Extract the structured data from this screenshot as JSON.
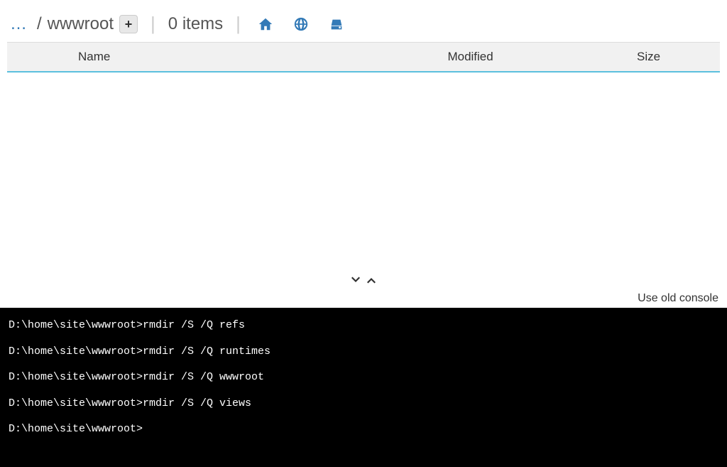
{
  "breadcrumb": {
    "ellipsis": "…",
    "slash": "/",
    "current": "wwwroot",
    "add_label": "+"
  },
  "toolbar": {
    "item_count": "0 items"
  },
  "table": {
    "headers": {
      "name": "Name",
      "modified": "Modified",
      "size": "Size"
    }
  },
  "console_link": "Use old console",
  "console_lines": [
    "D:\\home\\site\\wwwroot>rmdir /S /Q refs",
    "D:\\home\\site\\wwwroot>rmdir /S /Q runtimes",
    "D:\\home\\site\\wwwroot>rmdir /S /Q wwwroot",
    "D:\\home\\site\\wwwroot>rmdir /S /Q views",
    "D:\\home\\site\\wwwroot>"
  ]
}
